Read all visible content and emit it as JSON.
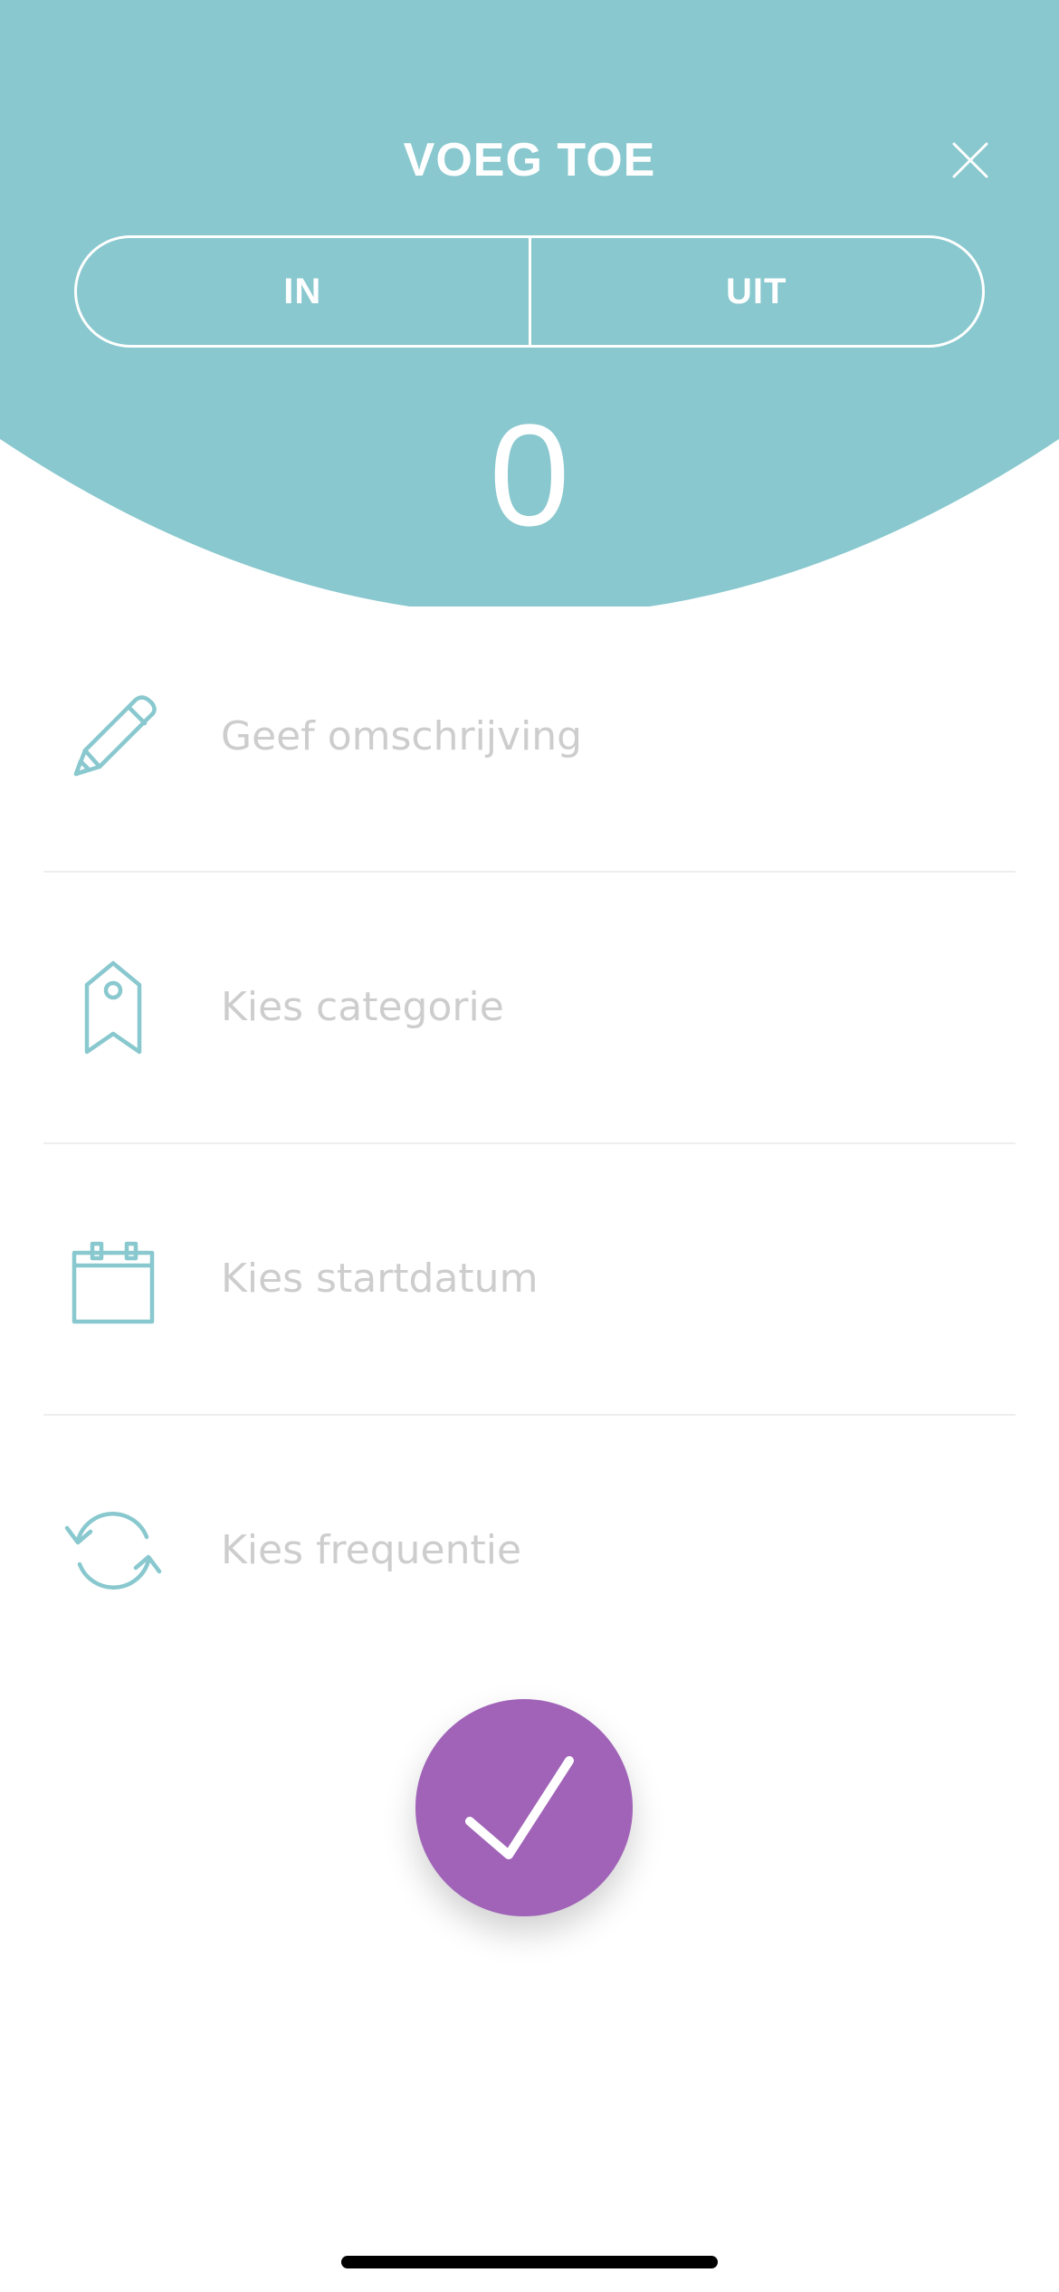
{
  "colors": {
    "teal": "#88C8CE",
    "purple": "#A063B8",
    "placeholder": "#CDCDCD",
    "white": "#FFFFFF"
  },
  "header": {
    "title": "VOEG TOE",
    "close_icon": "close-icon"
  },
  "toggle": {
    "in_label": "IN",
    "out_label": "UIT"
  },
  "amount": "0",
  "form": {
    "description": {
      "placeholder": "Geef omschrijving",
      "icon": "pencil-icon"
    },
    "category": {
      "placeholder": "Kies categorie",
      "icon": "tag-icon"
    },
    "start_date": {
      "placeholder": "Kies startdatum",
      "icon": "calendar-icon"
    },
    "frequency": {
      "placeholder": "Kies frequentie",
      "icon": "repeat-icon"
    }
  },
  "confirm": {
    "icon": "checkmark-icon"
  }
}
